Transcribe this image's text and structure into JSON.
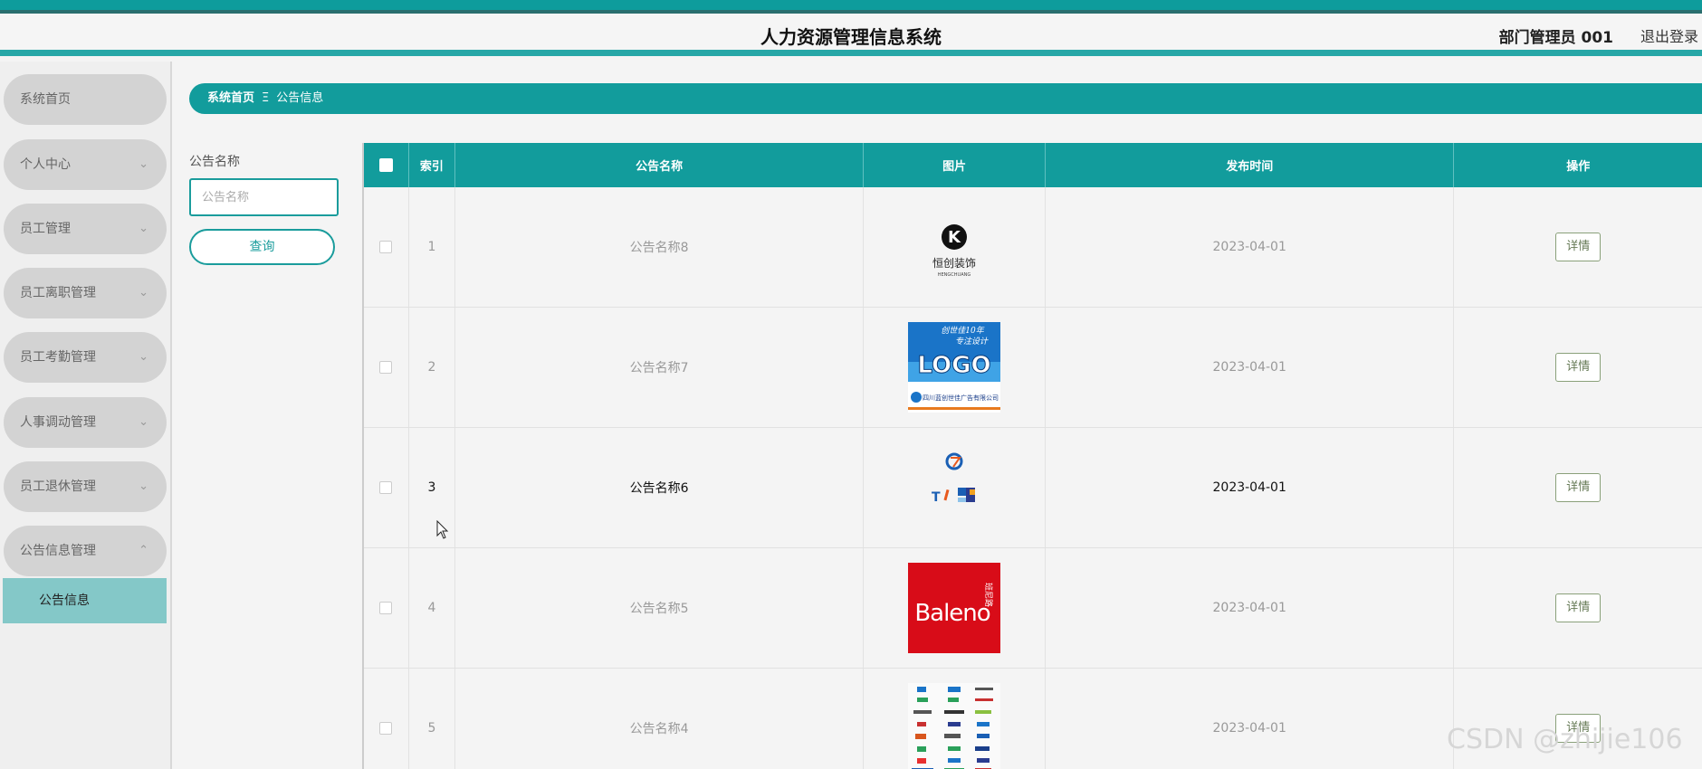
{
  "header": {
    "title": "人力资源管理信息系统",
    "user": "部门管理员 001",
    "logout_label": "退出登录"
  },
  "sidebar": {
    "items": [
      {
        "label": "系统首页",
        "expandable": false
      },
      {
        "label": "个人中心",
        "expandable": true
      },
      {
        "label": "员工管理",
        "expandable": true
      },
      {
        "label": "员工离职管理",
        "expandable": true
      },
      {
        "label": "员工考勤管理",
        "expandable": true
      },
      {
        "label": "人事调动管理",
        "expandable": true
      },
      {
        "label": "员工退休管理",
        "expandable": true
      },
      {
        "label": "公告信息管理",
        "expandable": true,
        "expanded": true
      }
    ],
    "sub_item": "公告信息",
    "chevron_down": "⌄",
    "chevron_up": "⌃"
  },
  "breadcrumb": {
    "home": "系统首页",
    "separator": "Ξ",
    "current": "公告信息"
  },
  "filter": {
    "label": "公告名称",
    "placeholder": "公告名称",
    "button_label": "查询"
  },
  "table": {
    "headers": {
      "index": "索引",
      "name": "公告名称",
      "image": "图片",
      "time": "发布时间",
      "action": "操作"
    },
    "rows": [
      {
        "index": "1",
        "name": "公告名称8",
        "time": "2023-04-01",
        "action": "详情",
        "image_icon": "hengchuang-logo-icon",
        "logo_text": "恒创装饰",
        "logo_sub": "HENGCHUANG",
        "logo_letter": "K"
      },
      {
        "index": "2",
        "name": "公告名称7",
        "time": "2023-04-01",
        "action": "详情",
        "image_icon": "logo-design-icon",
        "logo_text": "LOGO",
        "logo_top": "创世佳10年",
        "logo_top2": "专注设计",
        "logo_bottom": "四川蓝创世佳广告有限公司"
      },
      {
        "index": "3",
        "name": "公告名称6",
        "time": "2023-04-01",
        "action": "详情",
        "image_icon": "letter-logos-icon",
        "logo_letter": "T"
      },
      {
        "index": "4",
        "name": "公告名称5",
        "time": "2023-04-01",
        "action": "详情",
        "image_icon": "baleno-logo-icon",
        "logo_text": "Baleno",
        "logo_sub": "班尼路"
      },
      {
        "index": "5",
        "name": "公告名称4",
        "time": "2023-04-01",
        "action": "详情",
        "image_icon": "logo-collection-icon"
      }
    ],
    "active_row": 2
  },
  "watermark": "CSDN @zhijie106",
  "colors": {
    "accent": "#129c9c",
    "submenu": "#84c8c8",
    "nav_bg": "#d3d3d3",
    "baleno_red": "#d80c18",
    "logo_blue": "#1a74c8"
  }
}
